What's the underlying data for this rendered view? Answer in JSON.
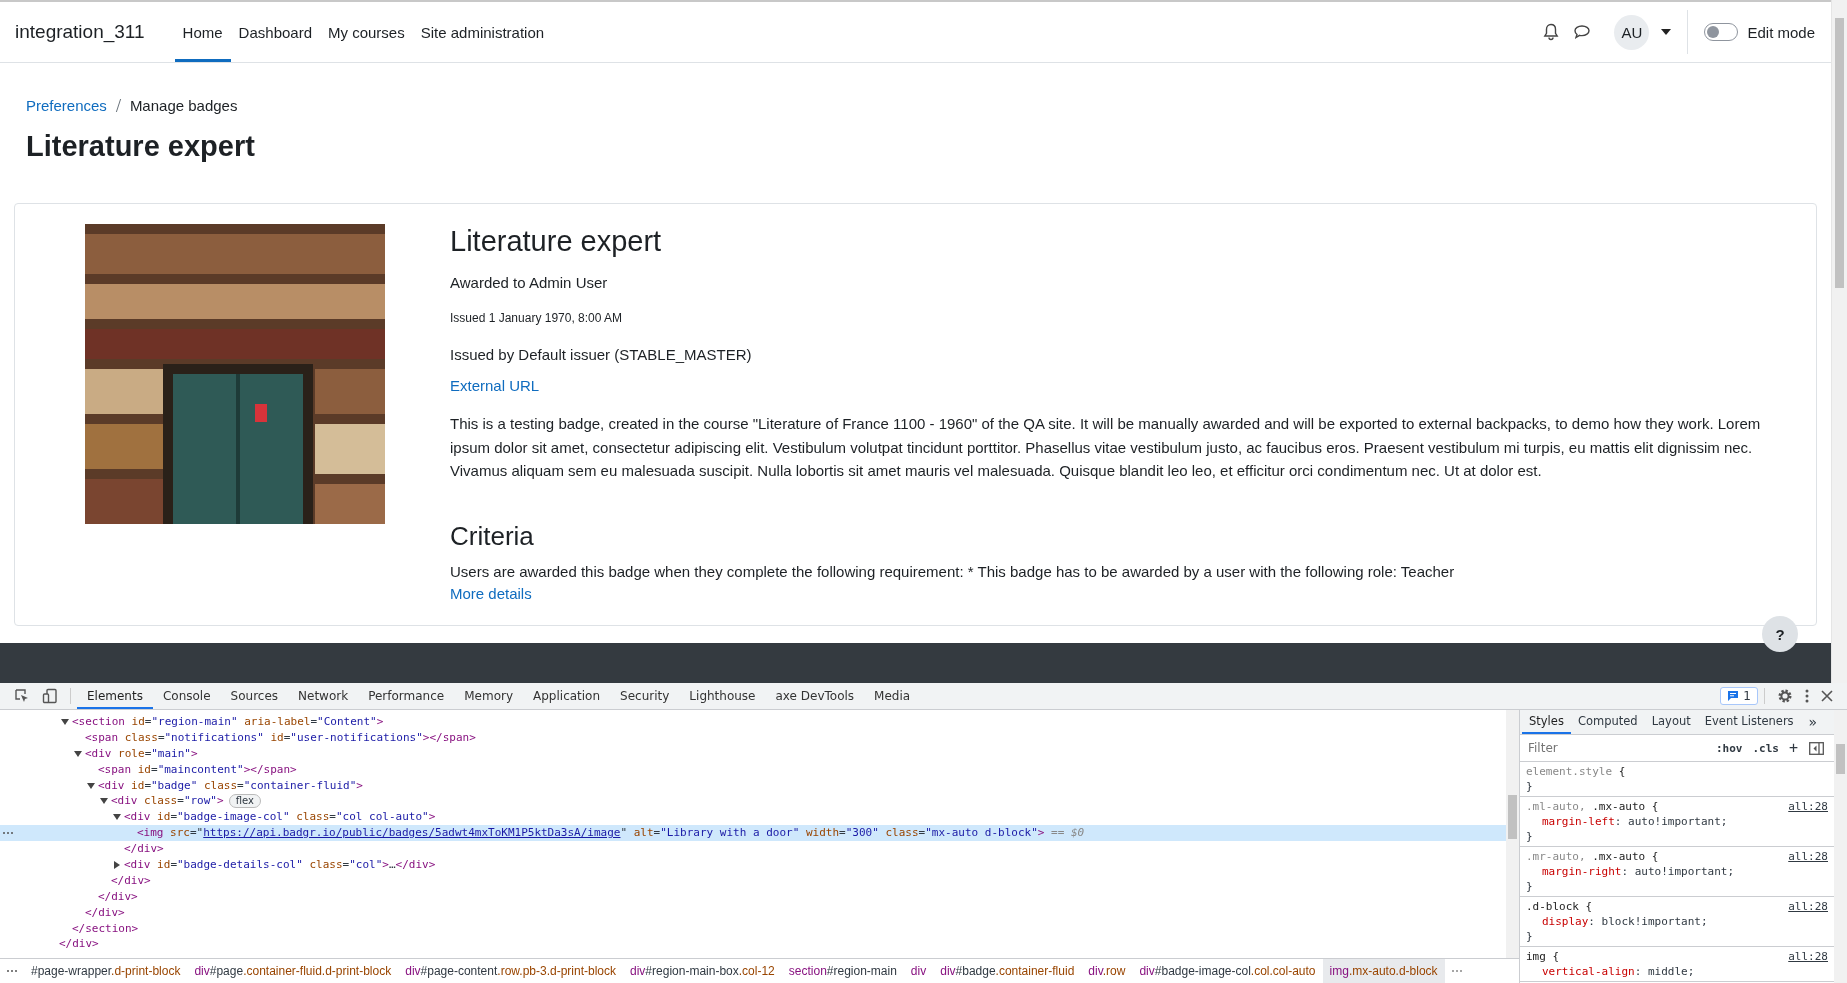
{
  "navbar": {
    "site_name": "integration_311",
    "nav": [
      {
        "label": "Home",
        "selected": true
      },
      {
        "label": "Dashboard",
        "selected": false
      },
      {
        "label": "My courses",
        "selected": false
      },
      {
        "label": "Site administration",
        "selected": false
      }
    ],
    "avatar": "AU",
    "edit_mode": {
      "label": "Edit mode",
      "on": false
    }
  },
  "breadcrumb": [
    {
      "label": "Preferences",
      "kind": "link"
    },
    {
      "label": "Manage badges",
      "kind": "current"
    }
  ],
  "page_title": "Literature expert",
  "badge": {
    "title": "Literature expert",
    "awarded_to": "Awarded to Admin User",
    "issued": "Issued 1 January 1970, 8:00 AM",
    "issued_by": "Issued by Default issuer (STABLE_MASTER)",
    "external_url": "External URL",
    "description": "This is a testing badge, created in the course \"Literature of France 1100 - 1960\" of the QA site. It will be manually awarded and will be exported to external backpacks, to demo how they work. Lorem ipsum dolor sit amet, consectetur adipiscing elit. Vestibulum volutpat tincidunt porttitor. Phasellus vitae vestibulum justo, ac faucibus eros. Praesent vestibulum mi turpis, eu mattis elit dignissim nec. Vivamus aliquam sem eu malesuada suscipit. Nulla lobortis sit amet mauris vel malesuada. Quisque blandit leo leo, et efficitur orci condimentum nec. Ut at dolor est.",
    "criteria_heading": "Criteria",
    "criteria": "Users are awarded this badge when they complete the following requirement: * This badge has to be awarded by a user with the following role: Teacher",
    "more_details": "More details"
  },
  "help_button": "?",
  "devtools": {
    "tabs": [
      {
        "label": "Elements",
        "selected": true
      },
      {
        "label": "Console",
        "selected": false
      },
      {
        "label": "Sources",
        "selected": false
      },
      {
        "label": "Network",
        "selected": false
      },
      {
        "label": "Performance",
        "selected": false
      },
      {
        "label": "Memory",
        "selected": false
      },
      {
        "label": "Application",
        "selected": false
      },
      {
        "label": "Security",
        "selected": false
      },
      {
        "label": "Lighthouse",
        "selected": false
      },
      {
        "label": "axe DevTools",
        "selected": false
      },
      {
        "label": "Media",
        "selected": false
      }
    ],
    "issues_count": "1",
    "dom_tree": {
      "children": [
        {
          "open": [
            {
              "kind": "tag",
              "text": "<section"
            },
            {
              "kind": "attr",
              "text": " id"
            },
            {
              "kind": "punct",
              "text": "="
            },
            {
              "kind": "val",
              "text": "\"region-main\""
            },
            {
              "kind": "attr",
              "text": " aria-label"
            },
            {
              "kind": "punct",
              "text": "="
            },
            {
              "kind": "val",
              "text": "\"Content\""
            },
            {
              "kind": "tag",
              "text": ">"
            }
          ],
          "expanded": true,
          "selected": false,
          "children": [
            {
              "open": [
                {
                  "kind": "tag",
                  "text": "<span"
                },
                {
                  "kind": "attr",
                  "text": " class"
                },
                {
                  "kind": "punct",
                  "text": "="
                },
                {
                  "kind": "val",
                  "text": "\"notifications\""
                },
                {
                  "kind": "attr",
                  "text": " id"
                },
                {
                  "kind": "punct",
                  "text": "="
                },
                {
                  "kind": "val",
                  "text": "\"user-notifications\""
                },
                {
                  "kind": "tag",
                  "text": "></span>"
                }
              ],
              "selected": false
            },
            {
              "open": [
                {
                  "kind": "tag",
                  "text": "<div"
                },
                {
                  "kind": "attr",
                  "text": " role"
                },
                {
                  "kind": "punct",
                  "text": "="
                },
                {
                  "kind": "val",
                  "text": "\"main\""
                },
                {
                  "kind": "tag",
                  "text": ">"
                }
              ],
              "expanded": true,
              "selected": false,
              "children": [
                {
                  "open": [
                    {
                      "kind": "tag",
                      "text": "<span"
                    },
                    {
                      "kind": "attr",
                      "text": " id"
                    },
                    {
                      "kind": "punct",
                      "text": "="
                    },
                    {
                      "kind": "val",
                      "text": "\"maincontent\""
                    },
                    {
                      "kind": "tag",
                      "text": "></span>"
                    }
                  ],
                  "selected": false
                },
                {
                  "open": [
                    {
                      "kind": "tag",
                      "text": "<div"
                    },
                    {
                      "kind": "attr",
                      "text": " id"
                    },
                    {
                      "kind": "punct",
                      "text": "="
                    },
                    {
                      "kind": "val",
                      "text": "\"badge\""
                    },
                    {
                      "kind": "attr",
                      "text": "  class"
                    },
                    {
                      "kind": "punct",
                      "text": "="
                    },
                    {
                      "kind": "val",
                      "text": "\"container-fluid\""
                    },
                    {
                      "kind": "tag",
                      "text": ">"
                    }
                  ],
                  "expanded": true,
                  "selected": false,
                  "children": [
                    {
                      "open": [
                        {
                          "kind": "tag",
                          "text": "<div"
                        },
                        {
                          "kind": "attr",
                          "text": " class"
                        },
                        {
                          "kind": "punct",
                          "text": "="
                        },
                        {
                          "kind": "val",
                          "text": "\"row\""
                        },
                        {
                          "kind": "tag",
                          "text": ">"
                        }
                      ],
                      "badge": "flex",
                      "expanded": true,
                      "selected": false,
                      "children": [
                        {
                          "open": [
                            {
                              "kind": "tag",
                              "text": "<div"
                            },
                            {
                              "kind": "attr",
                              "text": " id"
                            },
                            {
                              "kind": "punct",
                              "text": "="
                            },
                            {
                              "kind": "val",
                              "text": "\"badge-image-col\""
                            },
                            {
                              "kind": "attr",
                              "text": " class"
                            },
                            {
                              "kind": "punct",
                              "text": "="
                            },
                            {
                              "kind": "val",
                              "text": "\"col col-auto\""
                            },
                            {
                              "kind": "tag",
                              "text": ">"
                            }
                          ],
                          "expanded": true,
                          "selected": false,
                          "children": [
                            {
                              "open": [
                                {
                                  "kind": "tag",
                                  "text": "<img"
                                },
                                {
                                  "kind": "attr",
                                  "text": " src"
                                },
                                {
                                  "kind": "punct",
                                  "text": "=\""
                                },
                                {
                                  "kind": "link",
                                  "text": "https://api.badgr.io/public/badges/5adwt4mxToKM1P5ktDa3sA/image"
                                },
                                {
                                  "kind": "punct",
                                  "text": "\""
                                },
                                {
                                  "kind": "attr",
                                  "text": " alt"
                                },
                                {
                                  "kind": "punct",
                                  "text": "="
                                },
                                {
                                  "kind": "val",
                                  "text": "\"Library with a door\""
                                },
                                {
                                  "kind": "attr",
                                  "text": " width"
                                },
                                {
                                  "kind": "punct",
                                  "text": "="
                                },
                                {
                                  "kind": "val",
                                  "text": "\"300\""
                                },
                                {
                                  "kind": "attr",
                                  "text": " class"
                                },
                                {
                                  "kind": "punct",
                                  "text": "="
                                },
                                {
                                  "kind": "val",
                                  "text": "\"mx-auto d-block\""
                                },
                                {
                                  "kind": "tag",
                                  "text": ">"
                                },
                                {
                                  "kind": "ref",
                                  "text": " == $0"
                                }
                              ],
                              "selected": true
                            }
                          ],
                          "close": [
                            {
                              "kind": "tag",
                              "text": "</div>"
                            }
                          ]
                        },
                        {
                          "open": [
                            {
                              "kind": "tag",
                              "text": "<div"
                            },
                            {
                              "kind": "attr",
                              "text": " id"
                            },
                            {
                              "kind": "punct",
                              "text": "="
                            },
                            {
                              "kind": "val",
                              "text": "\"badge-details-col\""
                            },
                            {
                              "kind": "attr",
                              "text": " class"
                            },
                            {
                              "kind": "punct",
                              "text": "="
                            },
                            {
                              "kind": "val",
                              "text": "\"col\""
                            },
                            {
                              "kind": "tag",
                              "text": ">"
                            },
                            {
                              "kind": "punct",
                              "text": "…"
                            },
                            {
                              "kind": "tag",
                              "text": "</div>"
                            }
                          ],
                          "expanded": false,
                          "selected": false
                        }
                      ],
                      "close": [
                        {
                          "kind": "tag",
                          "text": "</div>"
                        }
                      ]
                    }
                  ],
                  "close": [
                    {
                      "kind": "tag",
                      "text": "</div>"
                    }
                  ]
                }
              ],
              "close": [
                {
                  "kind": "tag",
                  "text": "</div>"
                }
              ]
            }
          ],
          "close": [
            {
              "kind": "tag",
              "text": "</section>"
            }
          ]
        }
      ],
      "close": [
        {
          "kind": "tag",
          "text": "</div>"
        }
      ]
    },
    "breadcrumbs": [
      {
        "id": "#page-wrapper",
        "cls": ".d-print-block",
        "selected": false
      },
      {
        "tag": "div",
        "id": "#page",
        "cls": ".container-fluid.d-print-block",
        "selected": false
      },
      {
        "tag": "div",
        "id": "#page-content",
        "cls": ".row.pb-3.d-print-block",
        "selected": false
      },
      {
        "tag": "div",
        "id": "#region-main-box",
        "cls": ".col-12",
        "selected": false
      },
      {
        "tag": "section",
        "id": "#region-main",
        "selected": false
      },
      {
        "tag": "div",
        "selected": false
      },
      {
        "tag": "div",
        "id": "#badge",
        "cls": ".container-fluid",
        "selected": false
      },
      {
        "tag": "div",
        "cls": ".row",
        "selected": false
      },
      {
        "tag": "div",
        "id": "#badge-image-col",
        "cls": ".col.col-auto",
        "selected": false
      },
      {
        "tag": "img",
        "cls": ".mx-auto.d-block",
        "selected": true
      }
    ],
    "side_tabs": [
      {
        "label": "Styles",
        "selected": true
      },
      {
        "label": "Computed",
        "selected": false
      },
      {
        "label": "Layout",
        "selected": false
      },
      {
        "label": "Event Listeners",
        "selected": false
      }
    ],
    "side_more": "»",
    "filter": {
      "placeholder": "Filter"
    },
    "hov": ":hov",
    "cls": ".cls",
    "add": "+",
    "rules": [
      {
        "selector": [
          {
            "text": "element.style",
            "matched": false
          },
          {
            "text": " {",
            "matched": true
          }
        ],
        "close": "}"
      },
      {
        "selector": [
          {
            "text": ".ml-auto,",
            "matched": false
          },
          {
            "text": " .mx-auto {",
            "matched": true
          }
        ],
        "source": "all:28",
        "props": [
          {
            "name": "margin-left",
            "value": ": auto!important;"
          }
        ],
        "close": "}"
      },
      {
        "selector": [
          {
            "text": ".mr-auto,",
            "matched": false
          },
          {
            "text": " .mx-auto {",
            "matched": true
          }
        ],
        "source": "all:28",
        "props": [
          {
            "name": "margin-right",
            "value": ": auto!important;"
          }
        ],
        "close": "}"
      },
      {
        "selector": [
          {
            "text": ".d-block {",
            "matched": true
          }
        ],
        "source": "all:28",
        "props": [
          {
            "name": "display",
            "value": ": block!important;"
          }
        ],
        "close": "}"
      },
      {
        "selector": [
          {
            "text": "img {",
            "matched": true
          }
        ],
        "source": "all:28",
        "props": [
          {
            "name": "vertical-align",
            "value": ": middle;"
          }
        ]
      }
    ]
  }
}
